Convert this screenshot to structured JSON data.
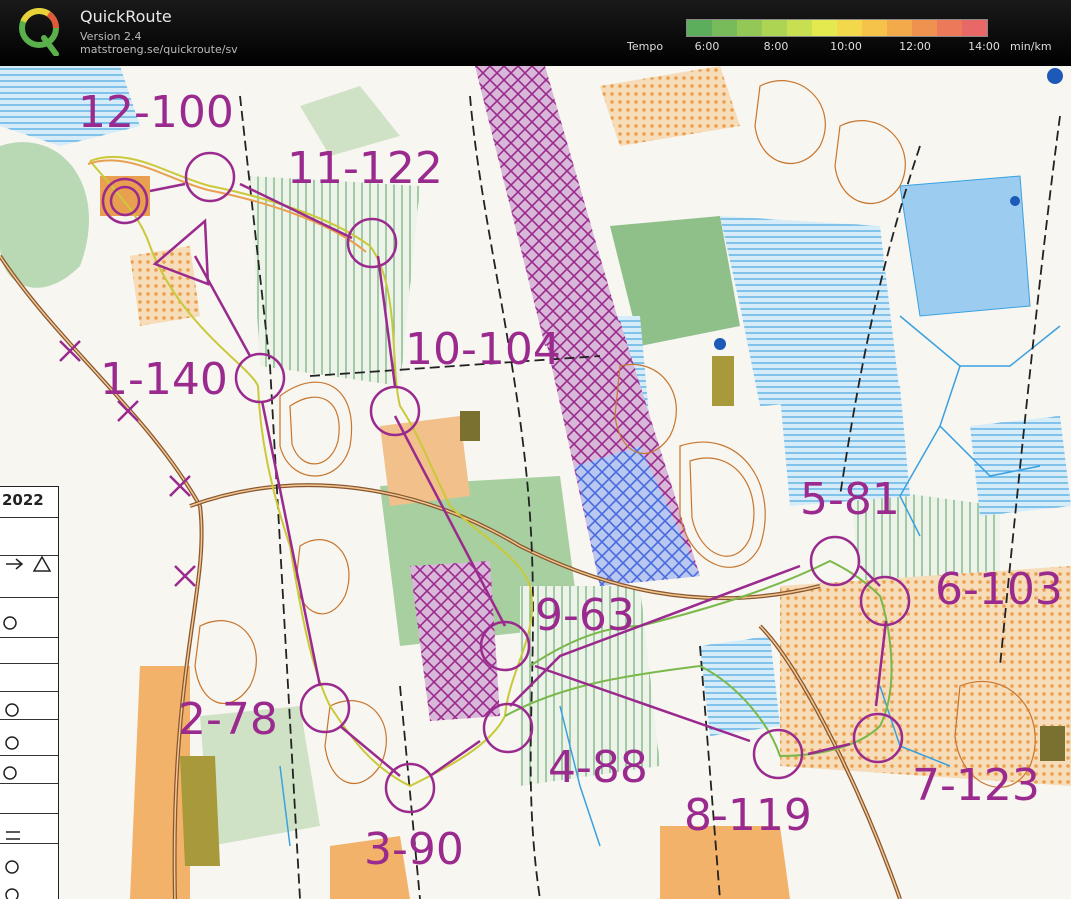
{
  "header": {
    "title": "QuickRoute",
    "version": "Version 2.4",
    "url": "matstroeng.se/quickroute/sv",
    "tempo_label": "Tempo",
    "tempo_ticks": [
      "6:00",
      "8:00",
      "10:00",
      "12:00",
      "14:00"
    ],
    "unit": "min/km",
    "scale_colors": [
      "#5cae5c",
      "#77bb5a",
      "#93c857",
      "#aed454",
      "#c9df52",
      "#e3e94f",
      "#f2d84a",
      "#f5c24a",
      "#f3aa4a",
      "#f0924f",
      "#ec7a5a",
      "#e86868"
    ]
  },
  "legend": {
    "year": "2022"
  },
  "controls": [
    {
      "label": "1-140"
    },
    {
      "label": "2-78"
    },
    {
      "label": "3-90"
    },
    {
      "label": "4-88"
    },
    {
      "label": "5-81"
    },
    {
      "label": "6-103"
    },
    {
      "label": "7-123"
    },
    {
      "label": "8-119"
    },
    {
      "label": "9-63"
    },
    {
      "label": "10-104"
    },
    {
      "label": "11-122"
    },
    {
      "label": "12-100"
    }
  ],
  "colors": {
    "course": "#9a2a8e",
    "route": "#c9c93a",
    "forest_green": "#7fb58a",
    "open_orange": "#f2b26a",
    "water_blue": "#3aa0e0",
    "contour_brown": "#c8762e"
  }
}
